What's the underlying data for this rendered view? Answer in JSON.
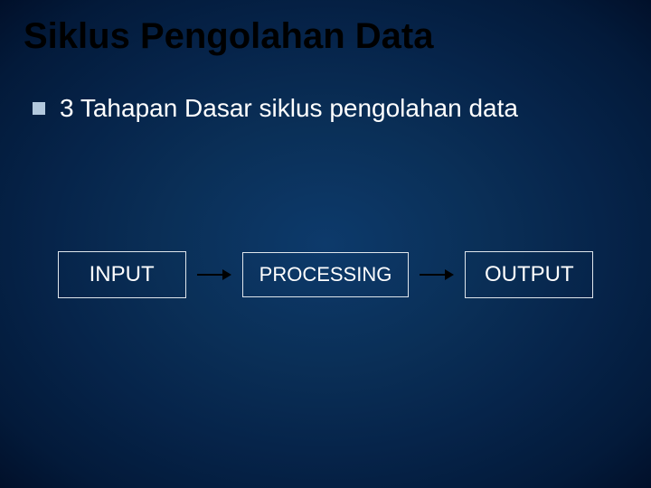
{
  "title": "Siklus Pengolahan Data",
  "bullet": {
    "text": "3 Tahapan Dasar siklus pengolahan data"
  },
  "flow": {
    "boxes": [
      {
        "label": "INPUT"
      },
      {
        "label": "PROCESSING"
      },
      {
        "label": "OUTPUT"
      }
    ]
  },
  "chart_data": {
    "type": "diagram",
    "style": "flowchart",
    "title": "Siklus Pengolahan Data",
    "subtitle": "3 Tahapan Dasar siklus pengolahan data",
    "nodes": [
      {
        "id": "input",
        "label": "INPUT"
      },
      {
        "id": "processing",
        "label": "PROCESSING"
      },
      {
        "id": "output",
        "label": "OUTPUT"
      }
    ],
    "edges": [
      {
        "from": "input",
        "to": "processing"
      },
      {
        "from": "processing",
        "to": "output"
      }
    ]
  }
}
